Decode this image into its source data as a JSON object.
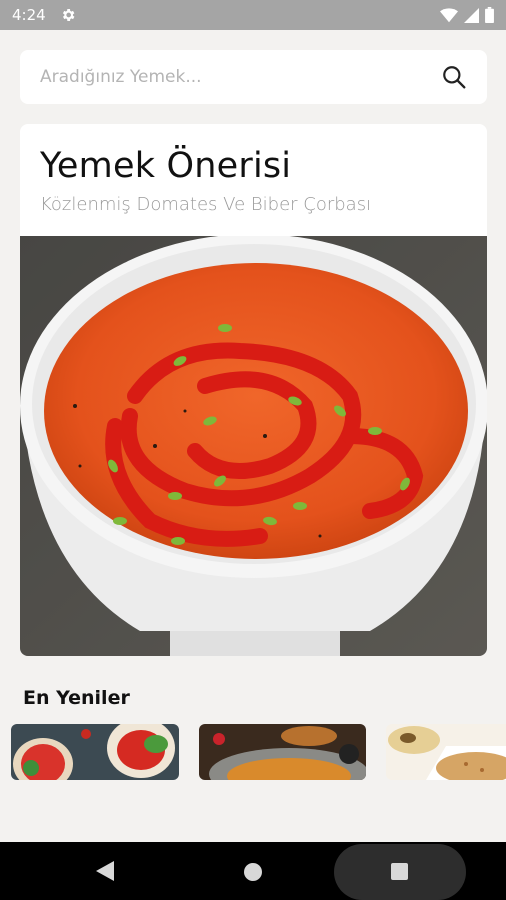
{
  "status_bar": {
    "time": "4:24",
    "icons": [
      "gear-icon",
      "wifi-icon",
      "signal-icon",
      "battery-icon"
    ]
  },
  "search": {
    "placeholder": "Aradığınız Yemek...",
    "icon": "search-icon"
  },
  "suggestion": {
    "title": "Yemek Önerisi",
    "dish_name": "Közlenmiş Domates Ve Biber Çorbası"
  },
  "latest": {
    "title": "En Yeniler",
    "items": [
      "bruschetta",
      "lentil-soup",
      "bulgur-pilaf"
    ]
  },
  "nav": {
    "buttons": [
      "back",
      "home",
      "recents"
    ]
  },
  "colors": {
    "background": "#f3f2f0",
    "status_bar": "#a5a5a5",
    "nav_bar": "#000000",
    "soup": "#e6531f"
  }
}
